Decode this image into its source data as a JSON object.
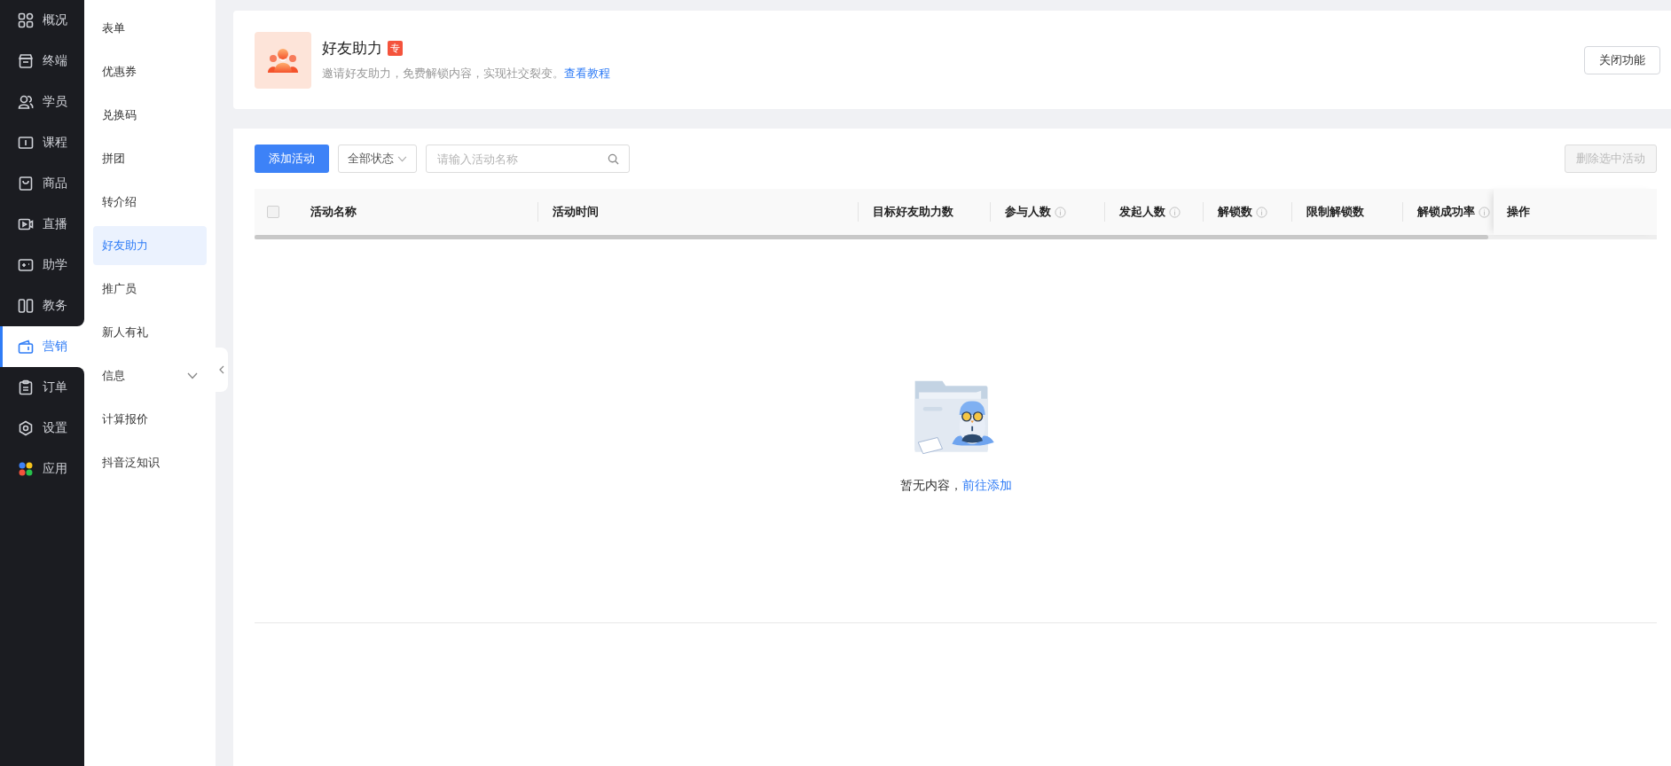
{
  "nav": {
    "items": [
      {
        "label": "概况",
        "selected": false
      },
      {
        "label": "终端",
        "selected": false
      },
      {
        "label": "学员",
        "selected": false
      },
      {
        "label": "课程",
        "selected": false
      },
      {
        "label": "商品",
        "selected": false
      },
      {
        "label": "直播",
        "selected": false
      },
      {
        "label": "助学",
        "selected": false
      },
      {
        "label": "教务",
        "selected": false
      },
      {
        "label": "营销",
        "selected": true
      },
      {
        "label": "订单",
        "selected": false
      },
      {
        "label": "设置",
        "selected": false
      },
      {
        "label": "应用",
        "selected": false
      }
    ]
  },
  "submenu": {
    "items": [
      {
        "label": "表单",
        "kind": "link",
        "selected": false
      },
      {
        "label": "优惠券",
        "kind": "link",
        "selected": false
      },
      {
        "label": "兑换码",
        "kind": "link",
        "selected": false
      },
      {
        "label": "拼团",
        "kind": "link",
        "selected": false
      },
      {
        "label": "转介绍",
        "kind": "link",
        "selected": false
      },
      {
        "label": "好友助力",
        "kind": "link",
        "selected": true
      },
      {
        "label": "推广员",
        "kind": "link",
        "selected": false
      },
      {
        "label": "新人有礼",
        "kind": "link",
        "selected": false
      },
      {
        "label": "信息",
        "kind": "group",
        "expanded": false,
        "selected": false
      },
      {
        "label": "计算报价",
        "kind": "link",
        "selected": false
      },
      {
        "label": "抖音泛知识",
        "kind": "link",
        "selected": false
      }
    ]
  },
  "header": {
    "title": "好友助力",
    "badge": "专",
    "description": "邀请好友助力，免费解锁内容，实现社交裂变。",
    "link": "查看教程",
    "close_button": "关闭功能"
  },
  "toolbar": {
    "add_button": "添加活动",
    "status_filter": "全部状态",
    "search": {
      "placeholder": "请输入活动名称"
    },
    "delete_button": {
      "label": "删除选中活动",
      "disabled": true
    }
  },
  "table": {
    "select_all": {
      "checked": false
    },
    "columns": [
      {
        "label": "活动名称",
        "info": false
      },
      {
        "label": "活动时间",
        "info": false
      },
      {
        "label": "目标好友助力数",
        "info": false
      },
      {
        "label": "参与人数",
        "info": true
      },
      {
        "label": "发起人数",
        "info": true
      },
      {
        "label": "解锁数",
        "info": true
      },
      {
        "label": "限制解锁数",
        "info": false
      },
      {
        "label": "解锁成功率",
        "info": true
      },
      {
        "label": "操作",
        "info": false
      }
    ],
    "empty": {
      "text": "暂无内容，",
      "link": "前往添加"
    }
  }
}
